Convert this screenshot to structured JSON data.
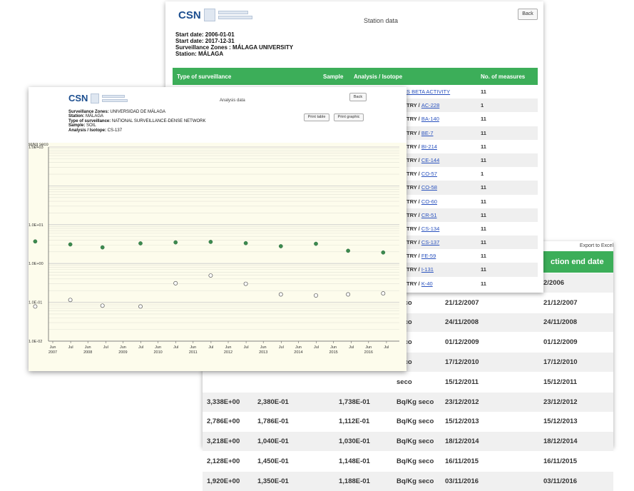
{
  "measures_window": {
    "excel_label": "Export to Excel",
    "header_label": "ction end date",
    "rows": [
      {
        "c1": "",
        "c2": "",
        "c3": "",
        "c4": "",
        "c5": "",
        "c6": "2/2006"
      },
      {
        "c1": "",
        "c2": "",
        "c3": "",
        "c4": "seco",
        "c5": "21/12/2007",
        "c6": "21/12/2007"
      },
      {
        "c1": "",
        "c2": "",
        "c3": "",
        "c4": "seco",
        "c5": "24/11/2008",
        "c6": "24/11/2008"
      },
      {
        "c1": "",
        "c2": "",
        "c3": "",
        "c4": "seco",
        "c5": "01/12/2009",
        "c6": "01/12/2009"
      },
      {
        "c1": "",
        "c2": "",
        "c3": "",
        "c4": "seco",
        "c5": "17/12/2010",
        "c6": "17/12/2010"
      },
      {
        "c1": "",
        "c2": "",
        "c3": "",
        "c4": "seco",
        "c5": "15/12/2011",
        "c6": "15/12/2011"
      },
      {
        "c1": "3,338E+00",
        "c2": "2,380E-01",
        "c3": "1,738E-01",
        "c4": "Bq/Kg seco",
        "c5": "23/12/2012",
        "c6": "23/12/2012"
      },
      {
        "c1": "2,786E+00",
        "c2": "1,786E-01",
        "c3": "1,112E-01",
        "c4": "Bq/Kg seco",
        "c5": "15/12/2013",
        "c6": "15/12/2013"
      },
      {
        "c1": "3,218E+00",
        "c2": "1,040E-01",
        "c3": "1,030E-01",
        "c4": "Bq/Kg seco",
        "c5": "18/12/2014",
        "c6": "18/12/2014"
      },
      {
        "c1": "2,128E+00",
        "c2": "1,450E-01",
        "c3": "1,148E-01",
        "c4": "Bq/Kg seco",
        "c5": "16/11/2015",
        "c6": "16/11/2015"
      },
      {
        "c1": "1,920E+00",
        "c2": "1,350E-01",
        "c3": "1,188E-01",
        "c4": "Bq/Kg seco",
        "c5": "03/11/2016",
        "c6": "03/11/2016"
      }
    ]
  },
  "station_window": {
    "logo_text": "CSN",
    "title": "Station data",
    "back_label": "Back",
    "info": [
      "Start date: 2006-01-01",
      "Start date: 2017-12-31",
      "Surveillance Zones : MÁLAGA UNIVERSITY",
      "Station: MÁLAGA"
    ],
    "columns": {
      "type": "Type of surveillance",
      "sample": "Sample",
      "analysis": "Analysis / Isotope",
      "measures": "No. of measures"
    },
    "rows": [
      {
        "prefix": "",
        "isotope": "S BETA ACTIVITY",
        "count": "11"
      },
      {
        "prefix": "TRY / ",
        "isotope": "AC-228",
        "count": "1"
      },
      {
        "prefix": "TRY / ",
        "isotope": "BA-140",
        "count": "11"
      },
      {
        "prefix": "TRY / ",
        "isotope": "BE-7",
        "count": "11"
      },
      {
        "prefix": "TRY / ",
        "isotope": "BI-214",
        "count": "11"
      },
      {
        "prefix": "TRY / ",
        "isotope": "CE-144",
        "count": "11"
      },
      {
        "prefix": "TRY / ",
        "isotope": "CO-57",
        "count": "1"
      },
      {
        "prefix": "TRY / ",
        "isotope": "CO-58",
        "count": "11"
      },
      {
        "prefix": "TRY / ",
        "isotope": "CO-60",
        "count": "11"
      },
      {
        "prefix": "TRY / ",
        "isotope": "CR-51",
        "count": "11"
      },
      {
        "prefix": "TRY / ",
        "isotope": "CS-134",
        "count": "11"
      },
      {
        "prefix": "TRY / ",
        "isotope": "CS-137",
        "count": "11"
      },
      {
        "prefix": "TRY / ",
        "isotope": "FE-59",
        "count": "11"
      },
      {
        "prefix": "TRY / ",
        "isotope": "I-131",
        "count": "11"
      },
      {
        "prefix": "TRY / ",
        "isotope": "K-40",
        "count": "11"
      }
    ]
  },
  "analysis_window": {
    "logo_text": "CSN",
    "title": "Analysis data",
    "back_label": "Back",
    "info": [
      {
        "label": "Surveillance Zones:",
        "value": " UNIVERSIDAD DE MÁLAGA"
      },
      {
        "label": "Station:",
        "value": " MÁLAGA"
      },
      {
        "label": "Type of surveillance:",
        "value": " NATIONAL SURVEILLANCE-DENSE NETWORK"
      },
      {
        "label": "Sample:",
        "value": " SOIL"
      },
      {
        "label": "Analysis / Isotope:",
        "value": " CS-137"
      }
    ],
    "buttons": {
      "table": "Print table",
      "graph": "Print graphic"
    }
  },
  "chart_data": {
    "type": "scatter",
    "ylabel": "Bq/kg seco",
    "y_scale": "log",
    "ylim": [
      0.01,
      1000
    ],
    "y_ticks": [
      "1.0E+03",
      "1.0E+01",
      "1.0E+00",
      "1.0E-01",
      "1.0E-02"
    ],
    "x_ticks": [
      {
        "month": "Jun",
        "year": "2007"
      },
      {
        "month": "Jul",
        "year": ""
      },
      {
        "month": "Jun",
        "year": "2008"
      },
      {
        "month": "Jul",
        "year": ""
      },
      {
        "month": "Jun",
        "year": "2009"
      },
      {
        "month": "Jul",
        "year": ""
      },
      {
        "month": "Jun",
        "year": "2010"
      },
      {
        "month": "Jul",
        "year": ""
      },
      {
        "month": "Jun",
        "year": "2011"
      },
      {
        "month": "Jul",
        "year": ""
      },
      {
        "month": "Jun",
        "year": "2012"
      },
      {
        "month": "Jul",
        "year": ""
      },
      {
        "month": "Jun",
        "year": "2013"
      },
      {
        "month": "Jul",
        "year": ""
      },
      {
        "month": "Jun",
        "year": "2014"
      },
      {
        "month": "Jul",
        "year": ""
      },
      {
        "month": "Jun",
        "year": "2015"
      },
      {
        "month": "Jul",
        "year": ""
      },
      {
        "month": "Jun",
        "year": "2016"
      },
      {
        "month": "Jul",
        "year": ""
      }
    ],
    "x": [
      "2006-12",
      "2007-12",
      "2008-11",
      "2009-12",
      "2010-12",
      "2011-12",
      "2012-12",
      "2013-12",
      "2014-12",
      "2015-11",
      "2016-11"
    ],
    "series": [
      {
        "values": [
          3.7,
          3.1,
          2.6,
          3.3,
          3.5,
          3.6,
          3.338,
          2.786,
          3.218,
          2.128,
          1.92
        ],
        "color": "#3c8a4f",
        "marker": "filled"
      },
      {
        "values": [
          0.078,
          0.115,
          0.082,
          0.078,
          0.31,
          0.49,
          0.3,
          0.16,
          0.15,
          0.16,
          0.17
        ],
        "color": "#555555",
        "marker": "open"
      }
    ],
    "grid": true
  },
  "colors": {
    "accent_green": "#3cae59",
    "link_blue": "#2a52be",
    "plot_bg": "#fdfcec"
  }
}
